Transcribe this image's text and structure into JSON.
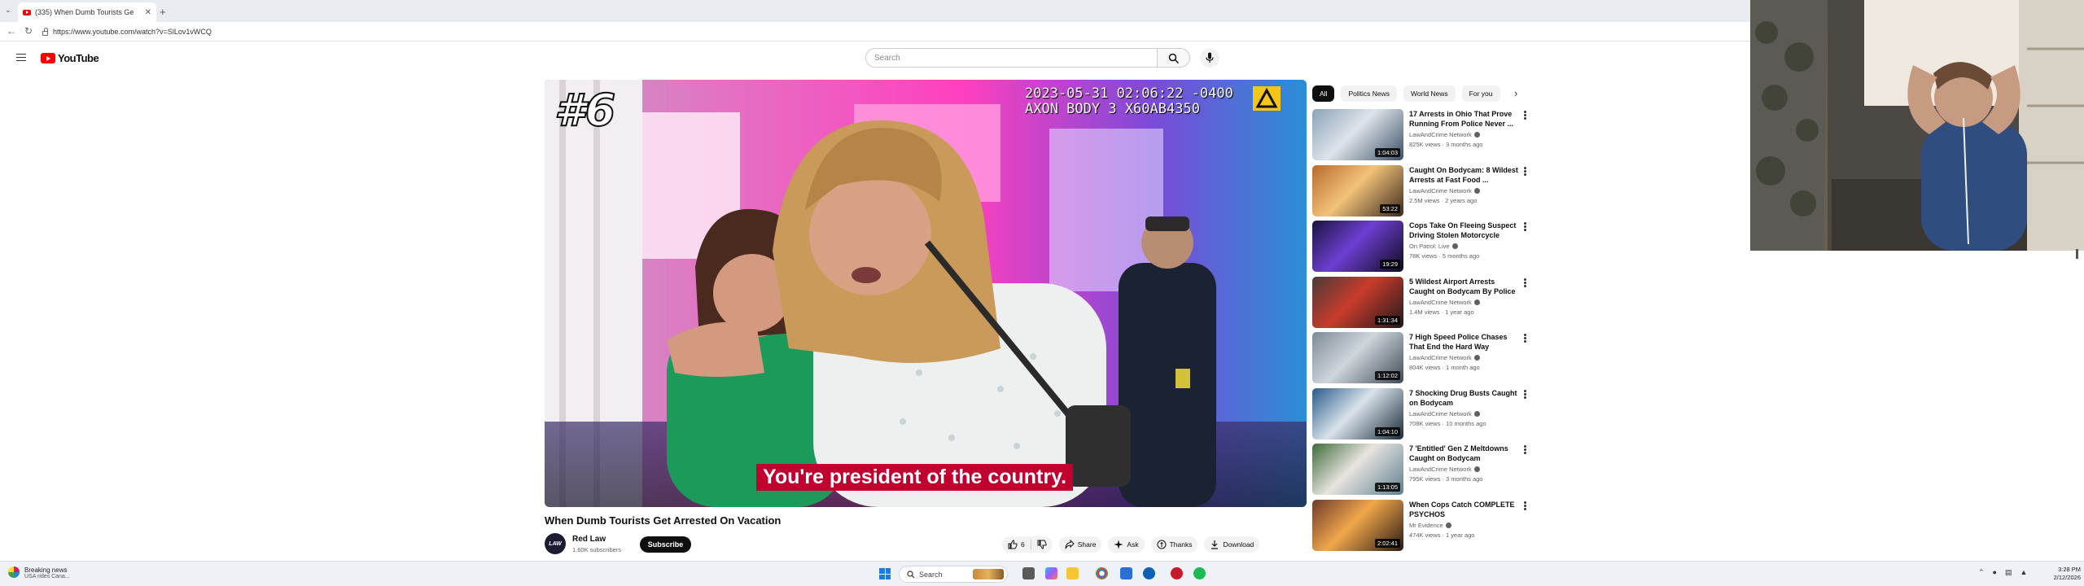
{
  "browser": {
    "tab_title": "(335) When Dumb Tourists Ge",
    "new_tab": "+",
    "url": "https://www.youtube.com/watch?v=SlLov1vWCQ"
  },
  "header": {
    "logo_text": "YouTube",
    "search_placeholder": "Search"
  },
  "player": {
    "rank_overlay": "#6",
    "bodycam_stamp_line1": "2023-05-31 02:06:22 -0400",
    "bodycam_stamp_line2": "AXON BODY 3 X60AB4350",
    "caption": "You're president of the country."
  },
  "video": {
    "title": "When Dumb Tourists Get Arrested On Vacation",
    "channel_name": "Red Law",
    "channel_avatar_text": "LAW",
    "subscribers": "1.60K subscribers",
    "subscribe_label": "Subscribe",
    "like_count": "6",
    "share_label": "Share",
    "ask_label": "Ask",
    "thanks_label": "Thanks",
    "download_label": "Download"
  },
  "chips": [
    "All",
    "Politics News",
    "World News",
    "For you"
  ],
  "related": [
    {
      "title": "17 Arrests in Ohio That Prove Running From Police Never ...",
      "channel": "LawAndCrime Network",
      "meta": "825K views · 3 months ago",
      "duration": "1:04:03",
      "colors": [
        "#8aa2b8",
        "#dfe4ea",
        "#3a4f66"
      ]
    },
    {
      "title": "Caught On Bodycam: 8 Wildest Arrests at Fast Food ...",
      "channel": "LawAndCrime Network",
      "meta": "2.5M views · 2 years ago",
      "duration": "53:22",
      "colors": [
        "#b86a2c",
        "#f2c27a",
        "#3c2a1c"
      ]
    },
    {
      "title": "Cops Take On Fleeing Suspect Driving Stolen Motorcycle",
      "channel": "On Patrol: Live",
      "meta": "78K views · 5 months ago",
      "duration": "19:29",
      "colors": [
        "#1a1340",
        "#6d3fd1",
        "#0c0b1c"
      ]
    },
    {
      "title": "5 Wildest Airport Arrests Caught on Bodycam By Police",
      "channel": "LawAndCrime Network",
      "meta": "1.4M views · 1 year ago",
      "duration": "1:31:34",
      "colors": [
        "#4a3a38",
        "#c83c2c",
        "#20181a"
      ]
    },
    {
      "title": "7 High Speed Police Chases That End the Hard Way",
      "channel": "LawAndCrime Network",
      "meta": "804K views · 1 month ago",
      "duration": "1:12:02",
      "colors": [
        "#7c8a96",
        "#cfd6dc",
        "#3e4a54"
      ]
    },
    {
      "title": "7 Shocking Drug Busts Caught on Bodycam",
      "channel": "LawAndCrime Network",
      "meta": "708K views · 10 months ago",
      "duration": "1:04:10",
      "colors": [
        "#2a5a8a",
        "#d8e2ea",
        "#1a2a3a"
      ]
    },
    {
      "title": "7 'Entitled' Gen Z Meltdowns Caught on Bodycam",
      "channel": "LawAndCrime Network",
      "meta": "795K views · 3 months ago",
      "duration": "1:13:05",
      "colors": [
        "#3f6a3a",
        "#e8e4df",
        "#5d7f8f"
      ]
    },
    {
      "title": "When Cops Catch COMPLETE PSYCHOS",
      "channel": "Mr Evidence",
      "meta": "474K views · 1 year ago",
      "duration": "2:02:41",
      "colors": [
        "#6e3b2a",
        "#f0a64a",
        "#2a1a14"
      ]
    }
  ],
  "taskbar": {
    "news_title": "Breaking news",
    "news_sub": "USA rides Cana...",
    "search_label": "Search",
    "time": "3:28 PM",
    "date": "2/12/2026"
  }
}
